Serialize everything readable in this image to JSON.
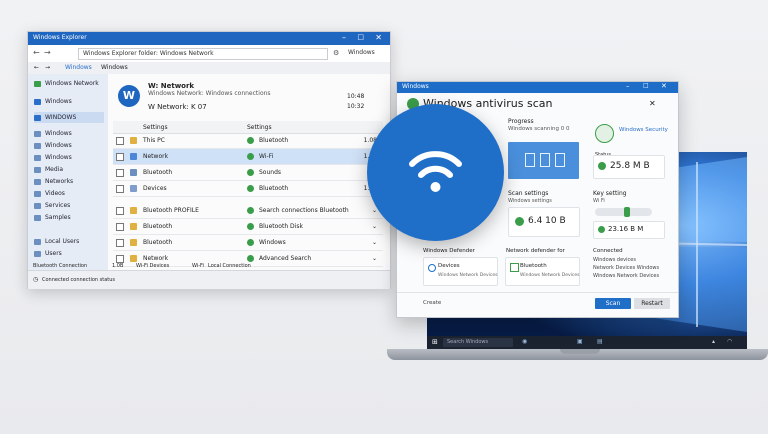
{
  "window1": {
    "title": "Windows Explorer",
    "address": "Windows Explorer folder: Windows Network",
    "tab": "Windows",
    "tab2": "Windows",
    "search": "Windows",
    "app_name": "W: Network",
    "app_desc": "Windows Network: Windows connections",
    "app_sub": "W Network: K 07",
    "time1": "10:48",
    "time2": "10:32",
    "sidebar": [
      {
        "label": "Windows Network",
        "color": "#3a9d4a"
      },
      {
        "label": "Windows",
        "color": "#2a6fc9"
      },
      {
        "label": "WINDOWS",
        "color": "#2a6fc9"
      },
      {
        "label": "Windows",
        "color": "#6a8fc0"
      },
      {
        "label": "Windows",
        "color": "#6a8fc0"
      },
      {
        "label": "Windows",
        "color": "#6a8fc0"
      },
      {
        "label": "Media",
        "color": "#6a8fc0"
      },
      {
        "label": "Networks",
        "color": "#6a8fc0"
      },
      {
        "label": "Videos",
        "color": "#6a8fc0"
      },
      {
        "label": "Services",
        "color": "#6a8fc0"
      },
      {
        "label": "Samples",
        "color": "#6a8fc0"
      },
      {
        "label": "Local Users",
        "color": "#6a8fc0"
      },
      {
        "label": "Users",
        "color": "#6a8fc0"
      }
    ],
    "header": {
      "col1": "Settings",
      "col2": "Settings"
    },
    "rows": [
      {
        "name": "This PC",
        "type": "Bluetooth",
        "size": "1.08",
        "selected": false
      },
      {
        "name": "Network",
        "type": "Wi-Fi",
        "size": "1.08",
        "selected": true
      },
      {
        "name": "Bluetooth",
        "type": "Sounds",
        "size": "",
        "selected": false
      },
      {
        "name": "Devices",
        "type": "Bluetooth",
        "size": "1.08",
        "selected": false
      },
      {
        "name": "Bluetooth PROFILE",
        "type": "Search connections Bluetooth",
        "size": "",
        "selected": false
      },
      {
        "name": "Bluetooth",
        "type": "Bluetooth Disk",
        "size": "",
        "selected": false
      },
      {
        "name": "Bluetooth",
        "type": "Windows",
        "size": "",
        "selected": false
      },
      {
        "name": "Network",
        "type": "Advanced Search",
        "size": "",
        "selected": false
      }
    ],
    "status_items": [
      "Bluetooth Connection",
      "1.0B",
      "Wi-Fi Devices",
      "Wi-Fi",
      "Local Connection"
    ],
    "status_line": "Connected connection status"
  },
  "window2": {
    "title": "Windows",
    "heading": "Windows antivirus scan",
    "progress_label": "Progress",
    "progress_sub": "Windows scanning 0 0",
    "shield_label": "Windows Security",
    "size_value": "25.8 M B",
    "size_label": "Status",
    "settings_label": "Scan settings",
    "settings_sub": "Windows settings",
    "settings_value": "6.4 10 B",
    "key_settings": "Key setting",
    "key_value": "23.16 B M",
    "key_sub": "Wi Fi",
    "card1_title": "Windows Defender",
    "card1_item": "Devices",
    "card1_sub": "Windows Network Devices",
    "card2_title": "Network defender for",
    "card2_item": "Bluetooth",
    "card2_sub": "Windows Network Devices",
    "card3_title": "Connected",
    "card3_lines": [
      "Windows devices",
      "Network Devices Windows",
      "Windows Network Devices"
    ],
    "footer_left": "Create",
    "btn_primary": "Scan",
    "btn_secondary": "Restart"
  },
  "laptop": {
    "search": "Search Windows"
  },
  "colors": {
    "accent": "#1f6fc9",
    "titlebar": "#1f66c1",
    "selection": "#cfe1f7",
    "green": "#3a9d4a"
  }
}
